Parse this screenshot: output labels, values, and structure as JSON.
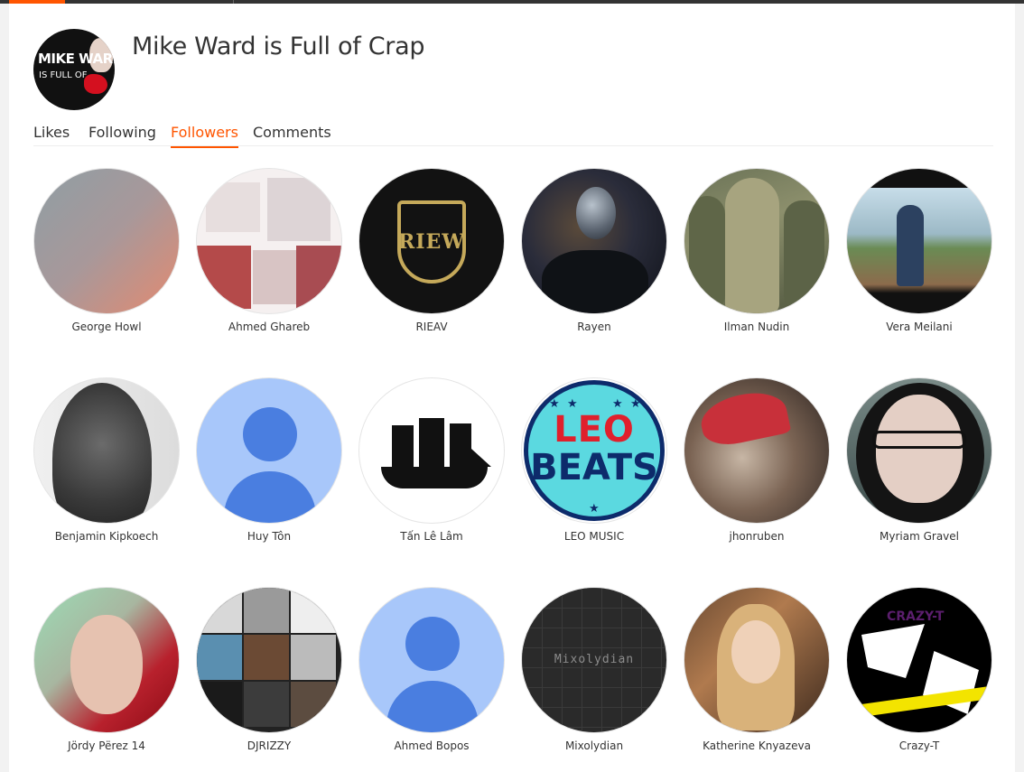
{
  "header": {
    "title": "Mike Ward is Full of Crap",
    "avatar_line1": "MIKE WARD",
    "avatar_line2": "IS FULL OF"
  },
  "tabs": [
    {
      "label": "Likes",
      "active": false
    },
    {
      "label": "Following",
      "active": false
    },
    {
      "label": "Followers",
      "active": true
    },
    {
      "label": "Comments",
      "active": false
    }
  ],
  "followers": [
    {
      "name": "George Howl"
    },
    {
      "name": "Ahmed Ghareb"
    },
    {
      "name": "RIEAV",
      "logo_text": "RIEW"
    },
    {
      "name": "Rayen"
    },
    {
      "name": "Ilman Nudin"
    },
    {
      "name": "Vera Meilani"
    },
    {
      "name": "Benjamin Kipkoech"
    },
    {
      "name": "Huy Tôn"
    },
    {
      "name": "Tấn Lê Lâm"
    },
    {
      "name": "LEO MUSIC",
      "logo_line1": "LEO",
      "logo_line2": "BEATS"
    },
    {
      "name": "jhonruben"
    },
    {
      "name": "Myriam Gravel"
    },
    {
      "name": "Jördy Përez 14"
    },
    {
      "name": "DJRIZZY"
    },
    {
      "name": "Ahmed Bopos"
    },
    {
      "name": "Mixolydian",
      "logo_text": "Mixolydian"
    },
    {
      "name": "Katherine Knyazeva"
    },
    {
      "name": "Crazy-T",
      "logo_text": "CRAZY-T"
    }
  ],
  "colors": {
    "accent": "#ff5500",
    "text": "#333333",
    "default_avatar_bg": "#a8c7fa",
    "default_avatar_fg": "#4a7ee0"
  }
}
